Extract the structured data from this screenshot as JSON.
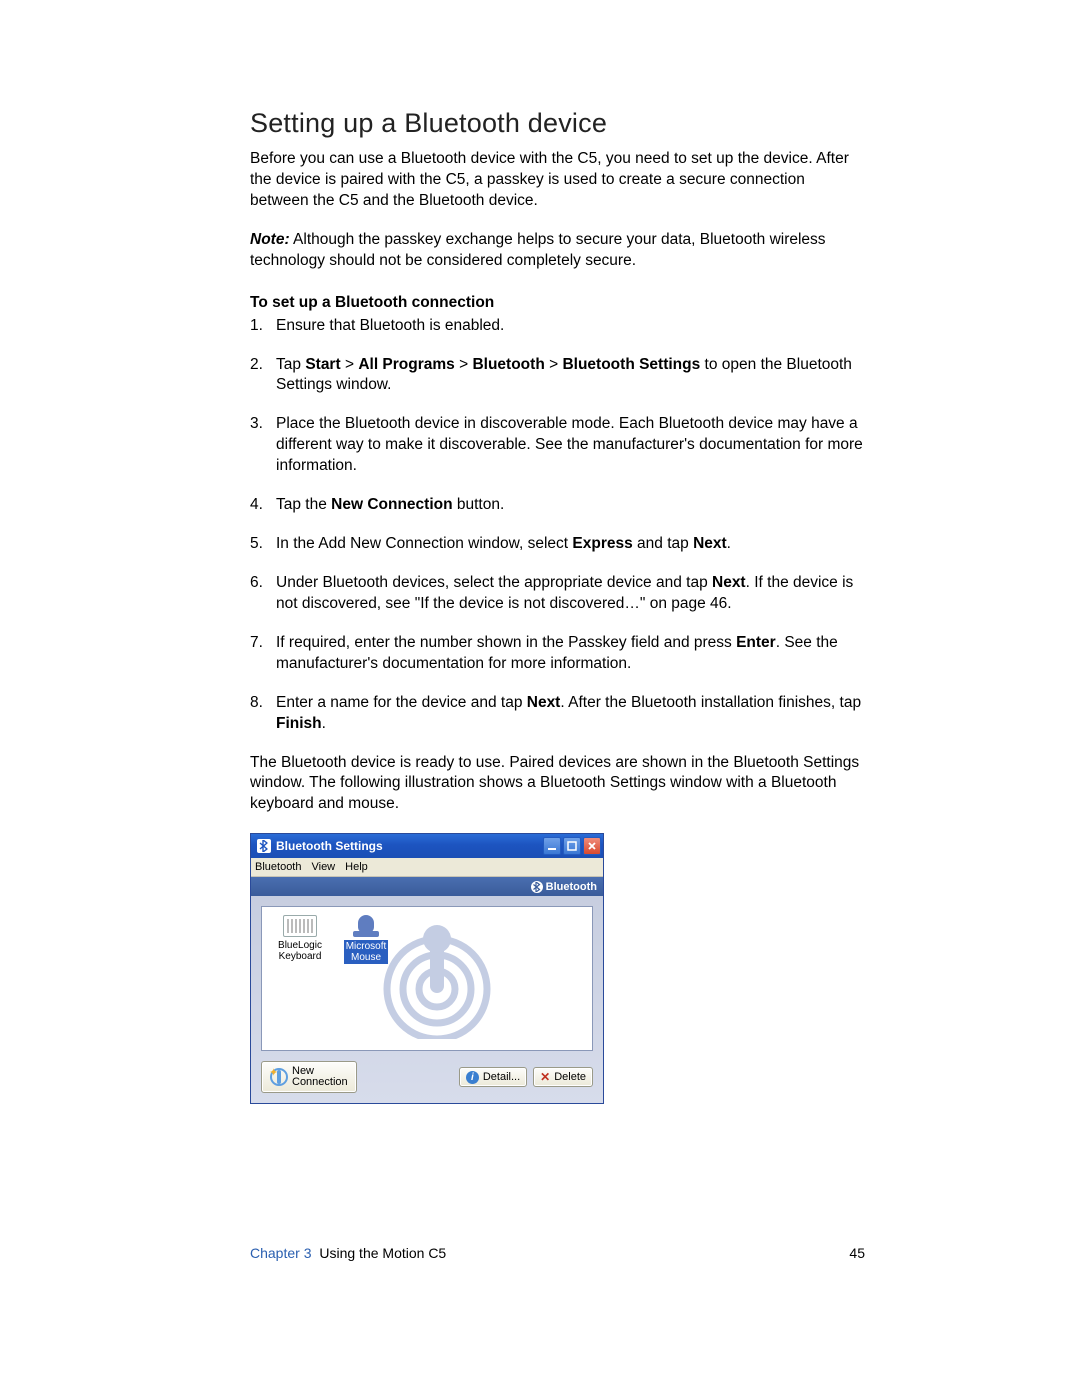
{
  "heading": "Setting up a Bluetooth device",
  "intro": "Before you can use a Bluetooth device with the C5, you need to set up the device. After the device is paired with the C5, a passkey is used to create a secure connection between the C5 and the Bluetooth device.",
  "note_label": "Note:",
  "note_text": " Although the passkey exchange helps to secure your data, Bluetooth wireless technology should not be considered completely secure.",
  "subhead": "To set up a Bluetooth connection",
  "steps": {
    "s1": "Ensure that Bluetooth is enabled.",
    "s2a": "Tap ",
    "s2_start": "Start",
    "s2_gt1": " > ",
    "s2_allprog": "All Programs",
    "s2_gt2": " > ",
    "s2_bt": "Bluetooth",
    "s2_gt3": " > ",
    "s2_btset": "Bluetooth Settings",
    "s2b": " to open the Bluetooth Settings window.",
    "s3": "Place the Bluetooth device in discoverable mode. Each Bluetooth device may have a different way to make it discoverable. See the manufacturer's documentation for more information.",
    "s4a": "Tap the ",
    "s4_nc": "New Connection",
    "s4b": " button.",
    "s5a": "In the Add New Connection window, select ",
    "s5_exp": "Express",
    "s5b": " and tap ",
    "s5_next": "Next",
    "s5c": ".",
    "s6a": "Under Bluetooth devices, select the appropriate device and tap ",
    "s6_next": "Next",
    "s6b": ". If the device is not discovered, see \"If the device is not discovered…\" on page 46.",
    "s7a": "If required, enter the number shown in the Passkey field and press ",
    "s7_enter": "Enter",
    "s7b": ". See the manufacturer's documentation for more information.",
    "s8a": "Enter a name for the device and tap ",
    "s8_next": "Next",
    "s8b": ". After the Bluetooth installation finishes, tap ",
    "s8_fin": "Finish",
    "s8c": "."
  },
  "closing": "The Bluetooth device is ready to use. Paired devices are shown in the Bluetooth Settings window. The following illustration shows a Bluetooth Settings window with a Bluetooth keyboard and mouse.",
  "window": {
    "title": "Bluetooth Settings",
    "menus": {
      "m1": "Bluetooth",
      "m2": "View",
      "m3": "Help"
    },
    "badge": "Bluetooth",
    "devices": {
      "d1": {
        "line1": "BlueLogic",
        "line2": "Keyboard"
      },
      "d2": {
        "line1": "Microsoft",
        "line2": "Mouse"
      }
    },
    "buttons": {
      "newconn_l1": "New",
      "newconn_l2": "Connection",
      "detail": "Detail...",
      "delete": "Delete"
    }
  },
  "footer": {
    "chapter": "Chapter 3",
    "title": "Using the Motion C5",
    "page": "45"
  }
}
